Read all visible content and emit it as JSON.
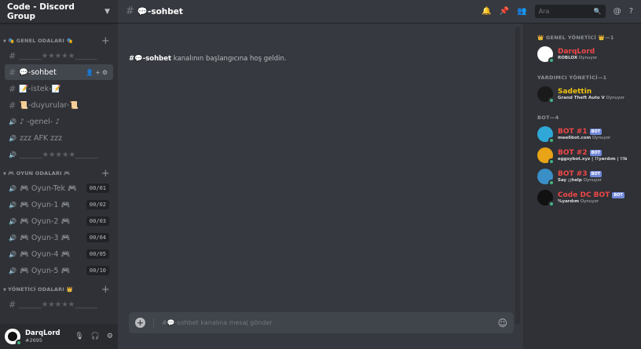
{
  "guild": {
    "name": "Code - Discord Group"
  },
  "categories": [
    {
      "label": "GENEL ODALARI",
      "prefix": "🎭",
      "suffix": "🎭",
      "channels": [
        {
          "type": "text",
          "name": "______★★★★★______",
          "active": false,
          "muted": true
        },
        {
          "type": "text",
          "name": "💬-sohbet",
          "active": true
        },
        {
          "type": "text",
          "name": "📝-istek-📝",
          "active": false
        },
        {
          "type": "text",
          "name": "📜-duyurular-📜",
          "active": false
        },
        {
          "type": "voice",
          "name": "♪ -genel- ♪",
          "active": false
        },
        {
          "type": "voice",
          "name": "zzz AFK zzz",
          "active": false
        },
        {
          "type": "voice",
          "name": "______★★★★★______",
          "active": false,
          "muted": true
        }
      ]
    },
    {
      "label": "OYUN ODALARI",
      "prefix": "🎮",
      "suffix": "🎮",
      "channels": [
        {
          "type": "voice",
          "name": "Oyun-Tek",
          "count": "00/01"
        },
        {
          "type": "voice",
          "name": "Oyun-1",
          "count": "00/02"
        },
        {
          "type": "voice",
          "name": "Oyun-2",
          "count": "00/03"
        },
        {
          "type": "voice",
          "name": "Oyun-3",
          "count": "00/04"
        },
        {
          "type": "voice",
          "name": "Oyun-4",
          "count": "00/05"
        },
        {
          "type": "voice",
          "name": "Oyun-5",
          "count": "00/10"
        }
      ]
    },
    {
      "label": "YÖNETİCİ ODALARI",
      "prefix": "",
      "suffix": "👑",
      "channels": [
        {
          "type": "text",
          "name": "______★★★★★______",
          "muted": true
        }
      ]
    }
  ],
  "user": {
    "name": "DarqLord",
    "tag": "#2695"
  },
  "topbar": {
    "channel": "💬-sohbet",
    "search_placeholder": "Ara"
  },
  "main": {
    "welcome_channel": "#💬-sohbet",
    "welcome_text": " kanalının başlangıcına hoş geldin.",
    "composer_placeholder": "#💬-sohbet kanalına mesaj gönder"
  },
  "members": {
    "groups": [
      {
        "label": "👑 GENEL YÖNETİCİ 👑—1",
        "items": [
          {
            "name": "DarqLord",
            "color": "#f04747",
            "activity": "ROBLOX",
            "suffix": " Oynuyor",
            "bot": false,
            "avatar": "#ffffff"
          }
        ]
      },
      {
        "label": "YARDIMCI YÖNETİCİ—1",
        "items": [
          {
            "name": "Sadettin",
            "color": "#f1c40f",
            "activity": "Grand Theft Auto V",
            "suffix": " Oynuyor",
            "bot": false,
            "avatar": "#1a1a1a"
          }
        ]
      },
      {
        "label": "BOT—4",
        "items": [
          {
            "name": "BOT #1",
            "color": "#f04747",
            "activity": "mee6bot.com",
            "suffix": " Oynuyor",
            "bot": true,
            "avatar": "#2fa8d8"
          },
          {
            "name": "BOT #2",
            "color": "#f04747",
            "activity": "eggsybot.xyz | !!yardım | !!bl...",
            "suffix": "",
            "bot": true,
            "avatar": "#e8a317"
          },
          {
            "name": "BOT #3",
            "color": "#f04747",
            "activity": "Say ;;help",
            "suffix": " Oynuyor",
            "bot": true,
            "avatar": "#3a8fc7"
          },
          {
            "name": "Code DC BOT",
            "color": "#f04747",
            "activity": "%yardım",
            "suffix": " Oynuyor",
            "bot": true,
            "avatar": "#111111"
          }
        ]
      }
    ],
    "bot_badge": "BOT"
  }
}
